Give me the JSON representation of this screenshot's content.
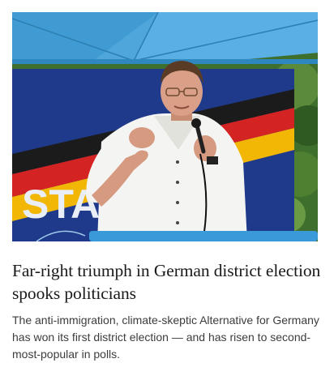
{
  "article": {
    "image": {
      "banner_text": "STA",
      "colors": {
        "tent": "#3f9bd1",
        "banner": "#1f3a8a",
        "stripe_black": "#1b1b1b",
        "stripe_red": "#d42323",
        "stripe_gold": "#f2b705",
        "shirt": "#f4f4f2",
        "foliage": "#3f6f2c",
        "table": "#3a9ad9"
      }
    },
    "headline": "Far-right triumph in German district election spooks politicians",
    "summary": "The anti-immigration, climate-skeptic Alternative for Germany has won its first district election — and has risen to second-most-popular in polls."
  }
}
